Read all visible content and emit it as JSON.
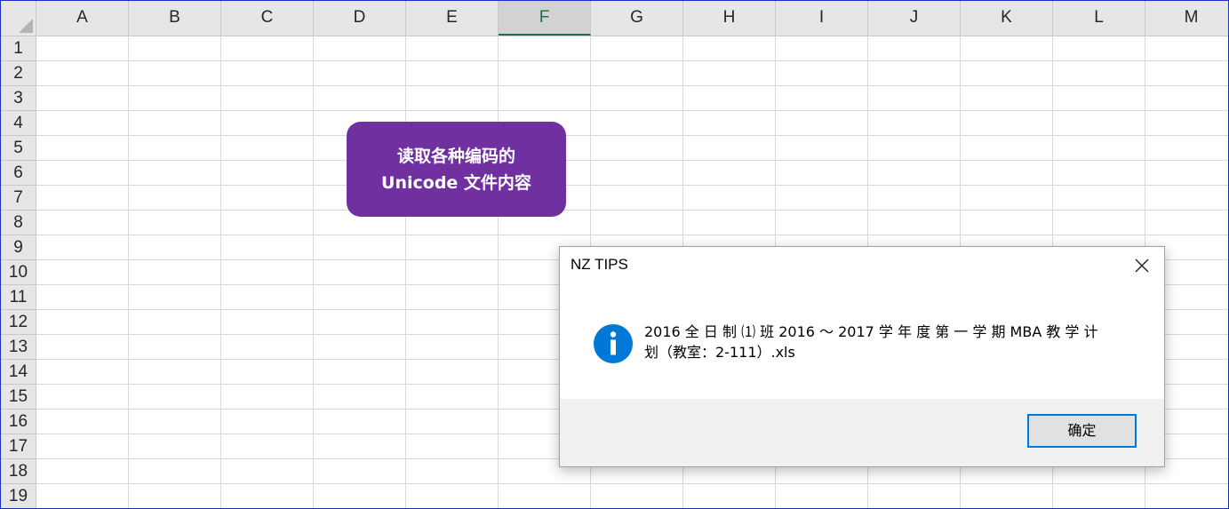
{
  "columns": [
    "A",
    "B",
    "C",
    "D",
    "E",
    "F",
    "G",
    "H",
    "I",
    "J",
    "K",
    "L",
    "M"
  ],
  "selected_column": "F",
  "rows": [
    "1",
    "2",
    "3",
    "4",
    "5",
    "6",
    "7",
    "8",
    "9",
    "10",
    "11",
    "12",
    "13",
    "14",
    "15",
    "16",
    "17",
    "18",
    "19"
  ],
  "shape": {
    "line1": "读取各种编码的",
    "line2": "Unicode 文件内容",
    "fill_color": "#7030a0"
  },
  "dialog": {
    "title": "NZ TIPS",
    "icon": "info-icon",
    "message_line1": "2016 全 日 制 ⑴ 班 2016 ～ 2017 学 年 度 第 一 学 期 MBA 教 学 计",
    "message_line2": "划（教室：2-111）.xls",
    "ok_label": "确定",
    "close_icon": "close-icon"
  },
  "colors": {
    "header_bg": "#e6e6e6",
    "gridline": "#d9d9d9",
    "selected_column_accent": "#217346",
    "info_blue": "#0078d7"
  }
}
